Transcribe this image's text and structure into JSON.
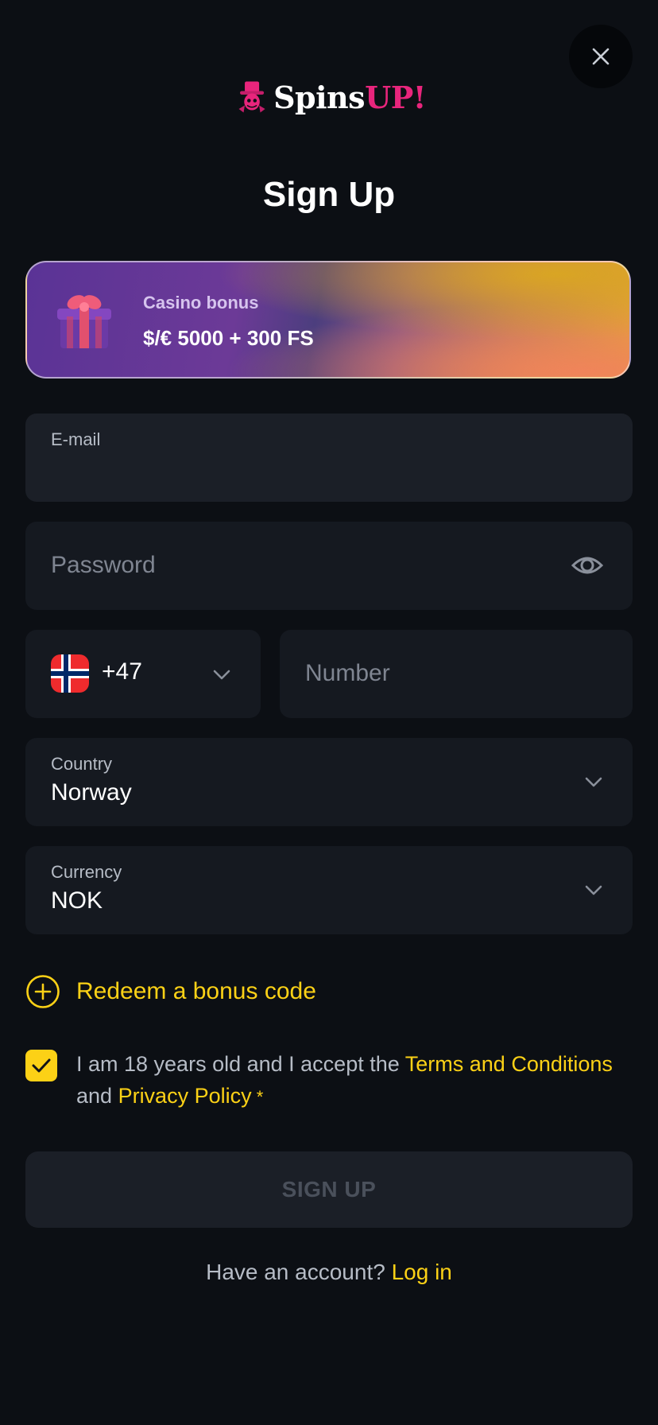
{
  "header": {
    "logo_text_white": "Spins",
    "logo_text_pink": "UP!",
    "title": "Sign Up"
  },
  "bonus": {
    "label": "Casino bonus",
    "value": "$/€ 5000 + 300 FS"
  },
  "form": {
    "email": {
      "label": "E-mail",
      "value": ""
    },
    "password": {
      "placeholder": "Password"
    },
    "phone": {
      "code": "+47",
      "placeholder": "Number"
    },
    "country": {
      "label": "Country",
      "value": "Norway"
    },
    "currency": {
      "label": "Currency",
      "value": "NOK"
    }
  },
  "redeem": {
    "label": "Redeem a bonus code"
  },
  "terms": {
    "checked": true,
    "text_before": "I am 18 years old and I accept the ",
    "terms_link": "Terms and Conditions",
    "text_and": " and ",
    "privacy_link": "Privacy Policy",
    "required_mark": " *"
  },
  "submit": {
    "label": "SIGN UP"
  },
  "footer": {
    "question": "Have an account? ",
    "login_link": "Log in"
  },
  "colors": {
    "background": "#0c0f14",
    "field": "#1b1f27",
    "accent": "#fcd116",
    "brand_pink": "#e8257c"
  },
  "icons": [
    "close-icon",
    "logo-mascot-icon",
    "gift-icon",
    "eye-icon",
    "norway-flag-icon",
    "chevron-down-icon",
    "plus-circle-icon",
    "check-icon"
  ]
}
